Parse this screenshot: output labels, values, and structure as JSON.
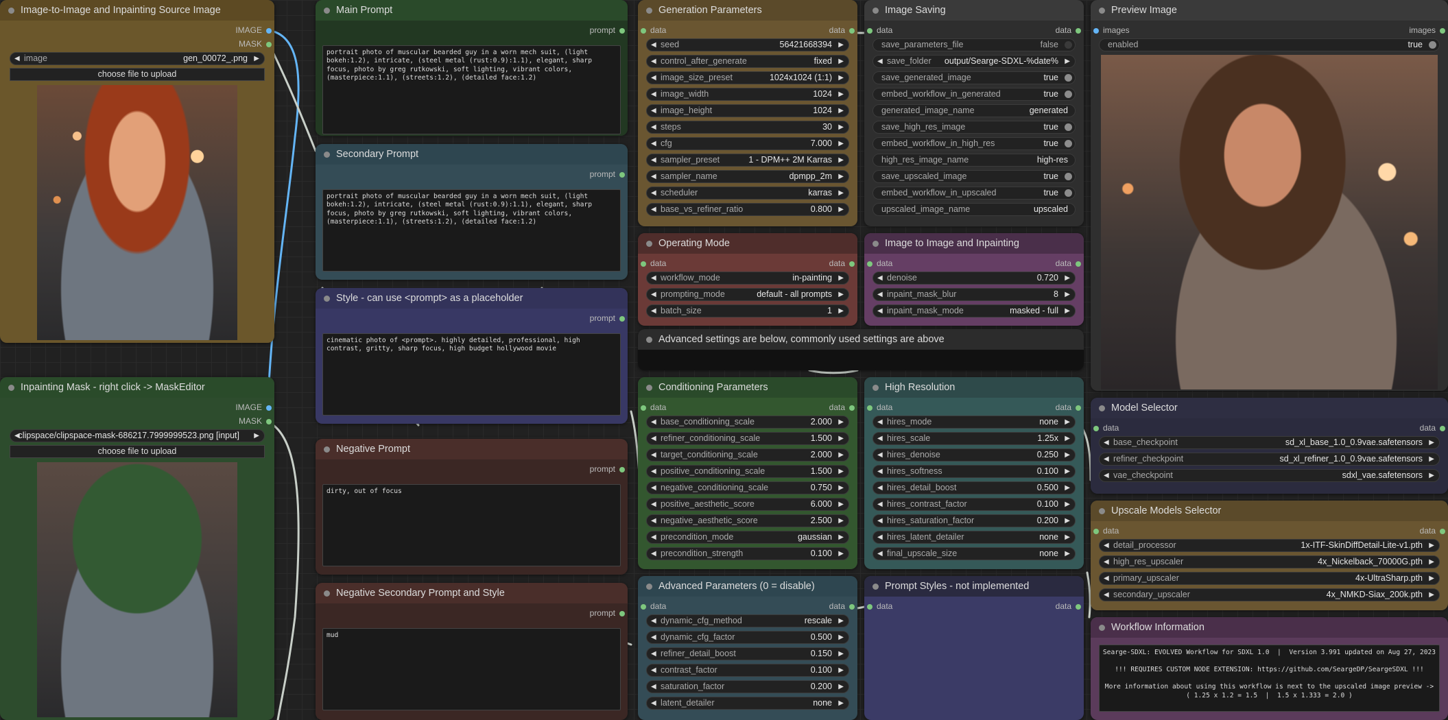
{
  "nodes": {
    "src": {
      "title": "Image-to-Image and Inpainting Source Image",
      "out1": "IMAGE",
      "out2": "MASK",
      "image_label": "image",
      "image_value": "gen_00072_.png",
      "upload": "choose file to upload"
    },
    "mask": {
      "title": "Inpainting Mask - right click -> MaskEditor",
      "out1": "IMAGE",
      "out2": "MASK",
      "image_value": "clipspace/clipspace-mask-686217.7999999523.png [input]",
      "upload": "choose file to upload"
    },
    "main_prompt": {
      "title": "Main Prompt",
      "out": "prompt",
      "text": "portrait photo of muscular bearded guy in a worn mech suit, (light bokeh:1.2), intricate, (steel metal (rust:0.9):1.1), elegant, sharp focus, photo by greg rutkowski, soft lighting, vibrant colors, (masterpiece:1.1), (streets:1.2), (detailed face:1.2)"
    },
    "secondary_prompt": {
      "title": "Secondary Prompt",
      "out": "prompt",
      "text": "portrait photo of muscular bearded guy in a worn mech suit, (light bokeh:1.2), intricate, (steel metal (rust:0.9):1.1), elegant, sharp focus, photo by greg rutkowski, soft lighting, vibrant colors, (masterpiece:1.1), (streets:1.2), (detailed face:1.2)"
    },
    "style": {
      "title": "Style - can use <prompt> as a placeholder",
      "out": "prompt",
      "text": "cinematic photo of <prompt>. highly detailed, professional, high contrast, gritty, sharp focus, high budget hollywood movie"
    },
    "negative": {
      "title": "Negative Prompt",
      "out": "prompt",
      "text": "dirty, out of focus"
    },
    "neg_secondary": {
      "title": "Negative Secondary Prompt and Style",
      "out": "prompt",
      "text": "mud"
    },
    "gen": {
      "title": "Generation Parameters",
      "in": "data",
      "out": "data",
      "widgets": [
        {
          "n": "seed",
          "v": "56421668394"
        },
        {
          "n": "control_after_generate",
          "v": "fixed"
        },
        {
          "n": "image_size_preset",
          "v": "1024x1024 (1:1)"
        },
        {
          "n": "image_width",
          "v": "1024"
        },
        {
          "n": "image_height",
          "v": "1024"
        },
        {
          "n": "steps",
          "v": "30"
        },
        {
          "n": "cfg",
          "v": "7.000"
        },
        {
          "n": "sampler_preset",
          "v": "1 - DPM++ 2M Karras"
        },
        {
          "n": "sampler_name",
          "v": "dpmpp_2m"
        },
        {
          "n": "scheduler",
          "v": "karras"
        },
        {
          "n": "base_vs_refiner_ratio",
          "v": "0.800"
        }
      ]
    },
    "saving": {
      "title": "Image Saving",
      "in": "data",
      "out": "data",
      "widgets": [
        {
          "n": "save_parameters_file",
          "v": "false",
          "t": true,
          "off": true
        },
        {
          "n": "save_folder",
          "v": "output/Searge-SDXL-%date%"
        },
        {
          "n": "save_generated_image",
          "v": "true",
          "t": true
        },
        {
          "n": "embed_workflow_in_generated",
          "v": "true",
          "t": true
        },
        {
          "n": "generated_image_name",
          "v": "generated",
          "s": true
        },
        {
          "n": "save_high_res_image",
          "v": "true",
          "t": true
        },
        {
          "n": "embed_workflow_in_high_res",
          "v": "true",
          "t": true
        },
        {
          "n": "high_res_image_name",
          "v": "high-res",
          "s": true
        },
        {
          "n": "save_upscaled_image",
          "v": "true",
          "t": true
        },
        {
          "n": "embed_workflow_in_upscaled",
          "v": "true",
          "t": true
        },
        {
          "n": "upscaled_image_name",
          "v": "upscaled",
          "s": true
        }
      ]
    },
    "preview": {
      "title": "Preview Image",
      "in": "images",
      "out": "images",
      "enabled_label": "enabled",
      "enabled_value": "true"
    },
    "opmode": {
      "title": "Operating Mode",
      "in": "data",
      "out": "data",
      "widgets": [
        {
          "n": "workflow_mode",
          "v": "in-painting"
        },
        {
          "n": "prompting_mode",
          "v": "default - all prompts"
        },
        {
          "n": "batch_size",
          "v": "1"
        }
      ]
    },
    "img2img": {
      "title": "Image to Image and Inpainting",
      "in": "data",
      "out": "data",
      "widgets": [
        {
          "n": "denoise",
          "v": "0.720"
        },
        {
          "n": "inpaint_mask_blur",
          "v": "8"
        },
        {
          "n": "inpaint_mask_mode",
          "v": "masked - full"
        }
      ]
    },
    "advanced_note": {
      "title": "Advanced settings are below, commonly used settings are above"
    },
    "cond": {
      "title": "Conditioning Parameters",
      "in": "data",
      "out": "data",
      "widgets": [
        {
          "n": "base_conditioning_scale",
          "v": "2.000"
        },
        {
          "n": "refiner_conditioning_scale",
          "v": "1.500"
        },
        {
          "n": "target_conditioning_scale",
          "v": "2.000"
        },
        {
          "n": "positive_conditioning_scale",
          "v": "1.500"
        },
        {
          "n": "negative_conditioning_scale",
          "v": "0.750"
        },
        {
          "n": "positive_aesthetic_score",
          "v": "6.000"
        },
        {
          "n": "negative_aesthetic_score",
          "v": "2.500"
        },
        {
          "n": "precondition_mode",
          "v": "gaussian"
        },
        {
          "n": "precondition_strength",
          "v": "0.100"
        }
      ]
    },
    "hires": {
      "title": "High Resolution",
      "in": "data",
      "out": "data",
      "widgets": [
        {
          "n": "hires_mode",
          "v": "none"
        },
        {
          "n": "hires_scale",
          "v": "1.25x"
        },
        {
          "n": "hires_denoise",
          "v": "0.250"
        },
        {
          "n": "hires_softness",
          "v": "0.100"
        },
        {
          "n": "hires_detail_boost",
          "v": "0.500"
        },
        {
          "n": "hires_contrast_factor",
          "v": "0.100"
        },
        {
          "n": "hires_saturation_factor",
          "v": "0.200"
        },
        {
          "n": "hires_latent_detailer",
          "v": "none"
        },
        {
          "n": "final_upscale_size",
          "v": "none"
        }
      ]
    },
    "model": {
      "title": "Model Selector",
      "in": "data",
      "out": "data",
      "widgets": [
        {
          "n": "base_checkpoint",
          "v": "sd_xl_base_1.0_0.9vae.safetensors"
        },
        {
          "n": "refiner_checkpoint",
          "v": "sd_xl_refiner_1.0_0.9vae.safetensors"
        },
        {
          "n": "vae_checkpoint",
          "v": "sdxl_vae.safetensors"
        }
      ]
    },
    "upscale": {
      "title": "Upscale Models Selector",
      "in": "data",
      "out": "data",
      "widgets": [
        {
          "n": "detail_processor",
          "v": "1x-ITF-SkinDiffDetail-Lite-v1.pth"
        },
        {
          "n": "high_res_upscaler",
          "v": "4x_Nickelback_70000G.pth"
        },
        {
          "n": "primary_upscaler",
          "v": "4x-UltraSharp.pth"
        },
        {
          "n": "secondary_upscaler",
          "v": "4x_NMKD-Siax_200k.pth"
        }
      ]
    },
    "adv": {
      "title": "Advanced Parameters (0 = disable)",
      "in": "data",
      "out": "data",
      "widgets": [
        {
          "n": "dynamic_cfg_method",
          "v": "rescale"
        },
        {
          "n": "dynamic_cfg_factor",
          "v": "0.500"
        },
        {
          "n": "refiner_detail_boost",
          "v": "0.150"
        },
        {
          "n": "contrast_factor",
          "v": "0.100"
        },
        {
          "n": "saturation_factor",
          "v": "0.200"
        },
        {
          "n": "latent_detailer",
          "v": "none"
        }
      ]
    },
    "styles": {
      "title": "Prompt Styles - not implemented",
      "in": "data",
      "out": "data"
    },
    "info": {
      "title": "Workflow Information",
      "text": "Searge-SDXL: EVOLVED Workflow for SDXL 1.0  |  Version 3.991 updated on Aug 27, 2023\n\n!!! REQUIRES CUSTOM NODE EXTENSION: https://github.com/SeargeDP/SeargeSDXL !!!\n\nMore information about using this workflow is next to the upscaled image preview ->\n( 1.25 x 1.2 = 1.5  |  1.5 x 1.333 = 2.0 )"
    }
  },
  "colors": {
    "canvas": "#212121",
    "wire_blue": "#64b5f6",
    "wire_light": "#c8cfc8",
    "slot_green": "#7ec77e"
  }
}
